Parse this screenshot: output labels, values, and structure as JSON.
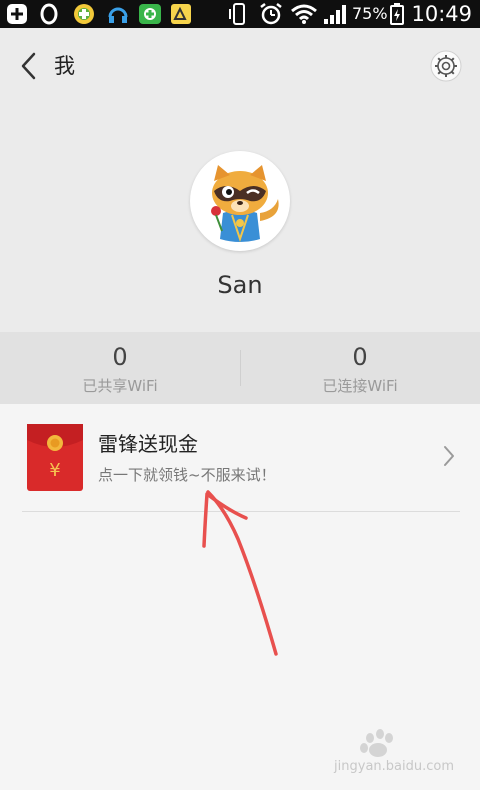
{
  "statusbar": {
    "battery_percent": "75%",
    "time": "10:49"
  },
  "header": {
    "title": "我",
    "username": "San"
  },
  "stats": [
    {
      "value": "0",
      "label": "已共享WiFi"
    },
    {
      "value": "0",
      "label": "已连接WiFi"
    }
  ],
  "promo": {
    "title": "雷锋送现金",
    "subtitle": "点一下就领钱~不服来试！",
    "packet_symbol": "¥"
  },
  "watermark": {
    "text": "jingyan.baidu.com"
  },
  "colors": {
    "status_bar": "#0f0f0f",
    "header_bg": "#ebebeb",
    "stats_bg": "#e1e1e1",
    "content_bg": "#f5f5f5",
    "red_packet": "#d92a2a",
    "annotation_arrow": "#e8504e"
  }
}
